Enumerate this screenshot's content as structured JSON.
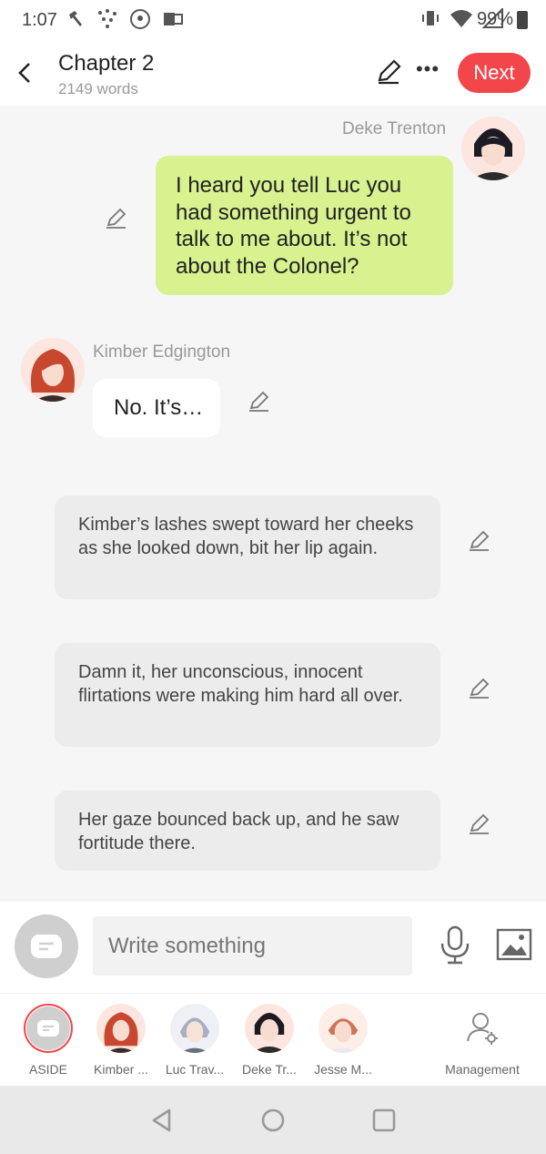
{
  "status_bar": {
    "time": "1:07",
    "battery": "99%"
  },
  "header": {
    "title": "Chapter 2",
    "subtitle": "2149 words",
    "next_label": "Next"
  },
  "messages": [
    {
      "speaker": "Deke Trenton",
      "text": "I heard you tell Luc you had something urgent to talk to me about. It’s not about the Colonel?"
    },
    {
      "speaker": "Kimber Edgington",
      "text": "No. It’s…"
    }
  ],
  "narration": [
    "Kimber’s lashes swept toward her cheeks as she looked down, bit her lip again.",
    "Damn it, her unconscious, innocent flirtations were making him hard all over.",
    "Her gaze bounced back up, and he saw fortitude there."
  ],
  "composer": {
    "placeholder": "Write something"
  },
  "characters": [
    {
      "label": "ASIDE"
    },
    {
      "label": "Kimber ..."
    },
    {
      "label": "Luc Trav..."
    },
    {
      "label": "Deke Tr..."
    },
    {
      "label": "Jesse M..."
    },
    {
      "label": "Management"
    }
  ],
  "colors": {
    "accent": "#f2464a",
    "sent_bubble": "#d7f28f",
    "narration_bg": "#ececec"
  }
}
